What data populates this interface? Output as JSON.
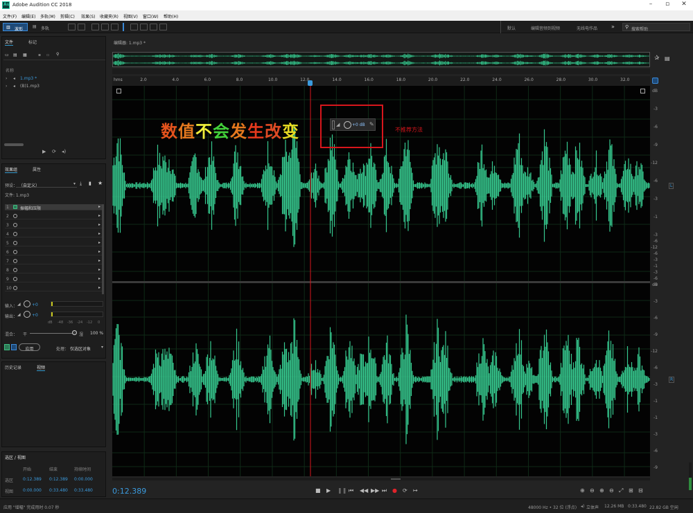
{
  "window": {
    "title": "Adobe Audition CC 2018",
    "logo": "Au"
  },
  "menu": [
    "文件(F)",
    "编辑(E)",
    "多轨(M)",
    "剪辑(C)",
    "效果(S)",
    "收藏夹(R)",
    "视图(V)",
    "窗口(W)",
    "帮助(H)"
  ],
  "toolbar": {
    "waveform_label": "波形",
    "multitrack_label": "多轨",
    "workspaces": [
      "默认",
      "编辑音频到视频",
      "无线电作品"
    ],
    "search_placeholder": "搜索帮助"
  },
  "files_panel": {
    "tabs": [
      "文件",
      "标记"
    ],
    "name_header": "名称",
    "items": [
      "1.mp3 *",
      "(B)1.mp3"
    ]
  },
  "effects_rack": {
    "tabs": [
      "效果组",
      "属性"
    ],
    "preset_label": "预设：",
    "preset_value": "（自定义）",
    "file_label": "文件: 1.mp3",
    "rows": [
      {
        "n": "1",
        "name": "振幅和压限"
      },
      {
        "n": "2",
        "name": ""
      },
      {
        "n": "3",
        "name": ""
      },
      {
        "n": "4",
        "name": ""
      },
      {
        "n": "5",
        "name": ""
      },
      {
        "n": "6",
        "name": ""
      },
      {
        "n": "7",
        "name": ""
      },
      {
        "n": "8",
        "name": ""
      },
      {
        "n": "9",
        "name": ""
      },
      {
        "n": "10",
        "name": ""
      }
    ],
    "input_label": "输入：",
    "input_value": "+0",
    "output_label": "输出：",
    "output_value": "+0",
    "meter_ticks": [
      "dB",
      "-48",
      "-36",
      "-24",
      "-12",
      "0"
    ],
    "mix_label": "混合：",
    "mix_dry": "干",
    "mix_wet": "湿",
    "mix_value": "100 %",
    "apply_label": "应用",
    "process_label": "处理：",
    "process_value": "仅选区对象"
  },
  "history_panel": {
    "tabs": [
      "历史记录",
      "视频"
    ]
  },
  "selection_panel": {
    "title": "选区 / 视图",
    "headers": [
      "开始",
      "结束",
      "持续时间"
    ],
    "rows": [
      {
        "label": "选区",
        "start": "0:12.389",
        "end": "0:12.389",
        "duration": "0:00.000"
      },
      {
        "label": "视图",
        "start": "0:00.000",
        "end": "0:33.480",
        "duration": "0:33.480"
      }
    ]
  },
  "editor": {
    "tab_label": "编辑器: 1.mp3 *",
    "ruler_labels": [
      "hms",
      "2.0",
      "4.0",
      "6.0",
      "8.0",
      "10.0",
      "12.0",
      "14.0",
      "16.0",
      "18.0",
      "20.0",
      "22.0",
      "24.0",
      "26.0",
      "28.0",
      "30.0",
      "32.0"
    ],
    "db_labels_top": [
      "dB",
      "-3",
      "-6",
      "-9",
      "-12",
      "-6",
      "-3",
      "-1"
    ],
    "db_labels_mid": [
      "-3",
      "-6",
      "-12",
      "-6",
      "-3",
      "-1",
      "-3",
      "-6",
      "-9"
    ],
    "db_labels_bottom": [
      "dB",
      "-3",
      "-6",
      "-9",
      "-12",
      "-6",
      "-3",
      "-1",
      "-1",
      "-3",
      "-6",
      "-9"
    ],
    "channel_top": "L",
    "channel_bottom": "R",
    "hud_value": "+0 dB",
    "waveform_color": "#36c98f",
    "playhead_color": "#d8161c"
  },
  "annotation": {
    "chars": [
      {
        "c": "数",
        "color": "#e4531d"
      },
      {
        "c": "值",
        "color": "#e5791f"
      },
      {
        "c": "不",
        "color": "#f1ef3b"
      },
      {
        "c": "会",
        "color": "#43d13a"
      },
      {
        "c": "发",
        "color": "#e5781e"
      },
      {
        "c": "生",
        "color": "#e5391d"
      },
      {
        "c": "改",
        "color": "#e04a24"
      },
      {
        "c": "变",
        "color": "#e6d922"
      }
    ],
    "red_label": "不推荐方法"
  },
  "transport": {
    "timecode": "0:12.389"
  },
  "status": {
    "left": "应用 \"增幅\" 完成用时 0.07 秒",
    "rate": "48000 Hz • 32 位 (浮点)",
    "channels": "立体声",
    "size": "12.26 MB",
    "duration": "0:33.480",
    "free": "22.82 GB 空闲"
  }
}
